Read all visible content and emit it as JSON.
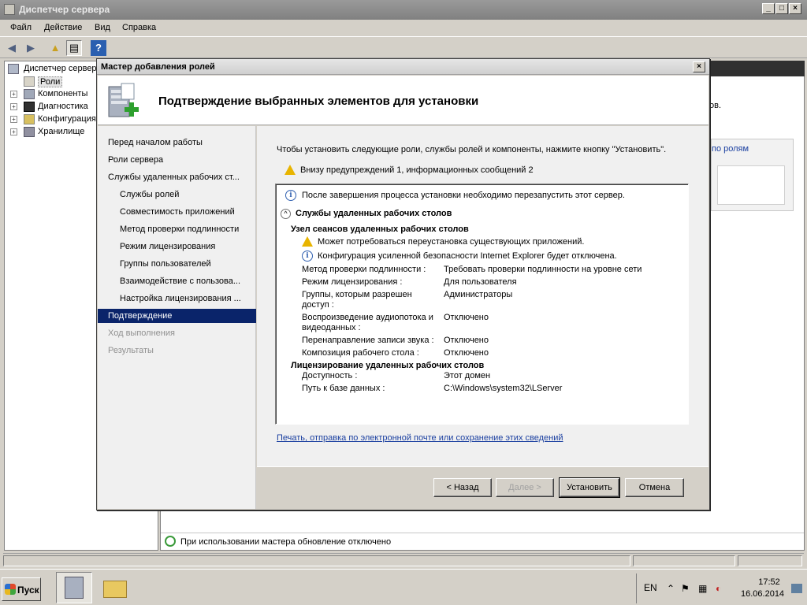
{
  "main_window": {
    "title": "Диспетчер сервера",
    "menu": [
      "Файл",
      "Действие",
      "Вид",
      "Справка"
    ],
    "tree": {
      "root": "Диспетчер сервер",
      "items": [
        "Роли",
        "Компоненты",
        "Диагностика",
        "Конфигурация",
        "Хранилище"
      ]
    },
    "right_fragment_1": "ов.",
    "right_link": "по ролям",
    "status_text": "При использовании мастера обновление отключено"
  },
  "dialog": {
    "title": "Мастер добавления ролей",
    "heading": "Подтверждение выбранных элементов для установки",
    "nav": [
      {
        "label": "Перед началом работы",
        "level": 0,
        "state": "normal"
      },
      {
        "label": "Роли сервера",
        "level": 0,
        "state": "normal"
      },
      {
        "label": "Службы удаленных рабочих ст...",
        "level": 0,
        "state": "normal"
      },
      {
        "label": "Службы ролей",
        "level": 1,
        "state": "normal"
      },
      {
        "label": "Совместимость приложений",
        "level": 1,
        "state": "normal"
      },
      {
        "label": "Метод проверки подлинности",
        "level": 1,
        "state": "normal"
      },
      {
        "label": "Режим лицензирования",
        "level": 1,
        "state": "normal"
      },
      {
        "label": "Группы пользователей",
        "level": 1,
        "state": "normal"
      },
      {
        "label": "Взаимодействие с пользова...",
        "level": 1,
        "state": "normal"
      },
      {
        "label": "Настройка лицензирования ...",
        "level": 1,
        "state": "normal"
      },
      {
        "label": "Подтверждение",
        "level": 0,
        "state": "selected"
      },
      {
        "label": "Ход выполнения",
        "level": 0,
        "state": "disabled"
      },
      {
        "label": "Результаты",
        "level": 0,
        "state": "disabled"
      }
    ],
    "intro": "Чтобы установить следующие роли, службы ролей и компоненты, нажмите кнопку \"Установить\".",
    "warning_summary": "Внизу предупреждений 1, информационных сообщений 2",
    "summary": {
      "restart_info": "После завершения процесса установки необходимо перезапустить этот сервер.",
      "section_title": "Службы удаленных рабочих столов",
      "subsection1": "Узел сеансов удаленных рабочих столов",
      "warning_msg": "Может потребоваться переустановка существующих приложений.",
      "info_msg": "Конфигурация усиленной безопасности Internet Explorer будет отключена.",
      "props1": [
        {
          "key": "Метод проверки подлинности :",
          "value": "Требовать проверки подлинности на уровне сети"
        },
        {
          "key": "Режим лицензирования :",
          "value": "Для пользователя"
        },
        {
          "key": "Группы, которым разрешен",
          "key2": "доступ :",
          "value": "Администраторы"
        },
        {
          "key": "Воспроизведение аудиопотока и",
          "key2": "видеоданных :",
          "value": "Отключено"
        },
        {
          "key": "Перенаправление записи звука :",
          "value": "Отключено"
        },
        {
          "key": "Композиция рабочего стола :",
          "value": "Отключено"
        }
      ],
      "subsection2": "Лицензирование удаленных рабочих столов",
      "props2": [
        {
          "key": "Доступность :",
          "value": "Этот домен"
        },
        {
          "key": "Путь к базе данных :",
          "value": "C:\\Windows\\system32\\LServer"
        }
      ]
    },
    "print_link": "Печать, отправка по электронной почте или сохранение этих сведений",
    "buttons": {
      "back": "< Назад",
      "next": "Далее >",
      "install": "Установить",
      "cancel": "Отмена"
    }
  },
  "taskbar": {
    "start": "Пуск",
    "lang": "EN",
    "time": "17:52",
    "date": "16.06.2014"
  }
}
